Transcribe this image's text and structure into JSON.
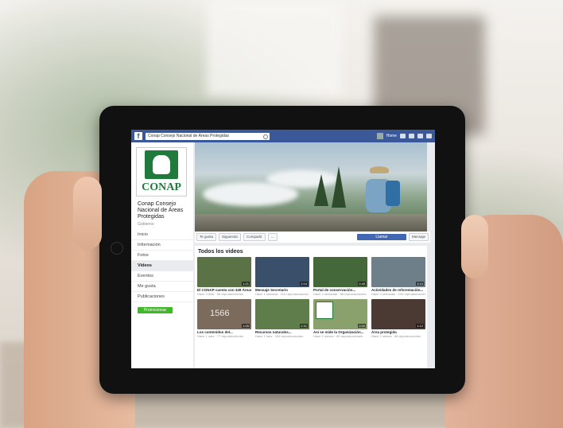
{
  "fb": {
    "logo": "f",
    "search_text": "Conap Consejo Nacional de Áreas Protegidas",
    "user_name": "Home"
  },
  "page": {
    "logo_text": "CONAP",
    "name": "Conap Consejo Nacional de Áreas Protegidas",
    "category": "Gobierno"
  },
  "menu": [
    {
      "label": "Inicio"
    },
    {
      "label": "Información"
    },
    {
      "label": "Fotos"
    },
    {
      "label": "Videos"
    },
    {
      "label": "Eventos"
    },
    {
      "label": "Me gusta"
    },
    {
      "label": "Publicaciones"
    }
  ],
  "promote_label": "Promocionar",
  "actions": {
    "liked": "Te gusta",
    "following": "Siguiendo",
    "share": "Compartir",
    "more": "...",
    "primary": "Llamar",
    "message": "Mensaje"
  },
  "videos": {
    "heading": "Todos los videos",
    "items": [
      {
        "title": "El CONAP cuenta con 349 Áreas...",
        "meta": "Hace 3 días · 65 reproducciones",
        "duration": "1:21",
        "color": "#5b7247"
      },
      {
        "title": "Mensaje Secretario",
        "meta": "Hace 1 semana · 210 reproducciones",
        "duration": "2:04",
        "color": "#3a4f6a"
      },
      {
        "title": "Portal de conservación...",
        "meta": "Hace 2 semanas · 98 reproducciones",
        "duration": "0:48",
        "color": "#45683a"
      },
      {
        "title": "Actividades de reforestación...",
        "meta": "Hace 3 semanas · 120 reproducciones",
        "duration": "3:10",
        "color": "#6f7f8a"
      },
      {
        "title": "Los contenidos del...",
        "meta": "Hace 1 mes · 77 reproducciones",
        "duration": "1:55",
        "color": "#7a6b5c"
      },
      {
        "title": "Recursos naturales...",
        "meta": "Hace 1 mes · 154 reproducciones",
        "duration": "2:31",
        "color": "#5e7d4a"
      },
      {
        "title": "Así se mide la Organización...",
        "meta": "Hace 2 meses · 60 reproducciones",
        "duration": "0:59",
        "color": "#8aa16d"
      },
      {
        "title": "Área protegida",
        "meta": "Hace 2 meses · 88 reproducciones",
        "duration": "1:12",
        "color": "#4a3a33"
      }
    ],
    "overlay_number": "1566"
  }
}
